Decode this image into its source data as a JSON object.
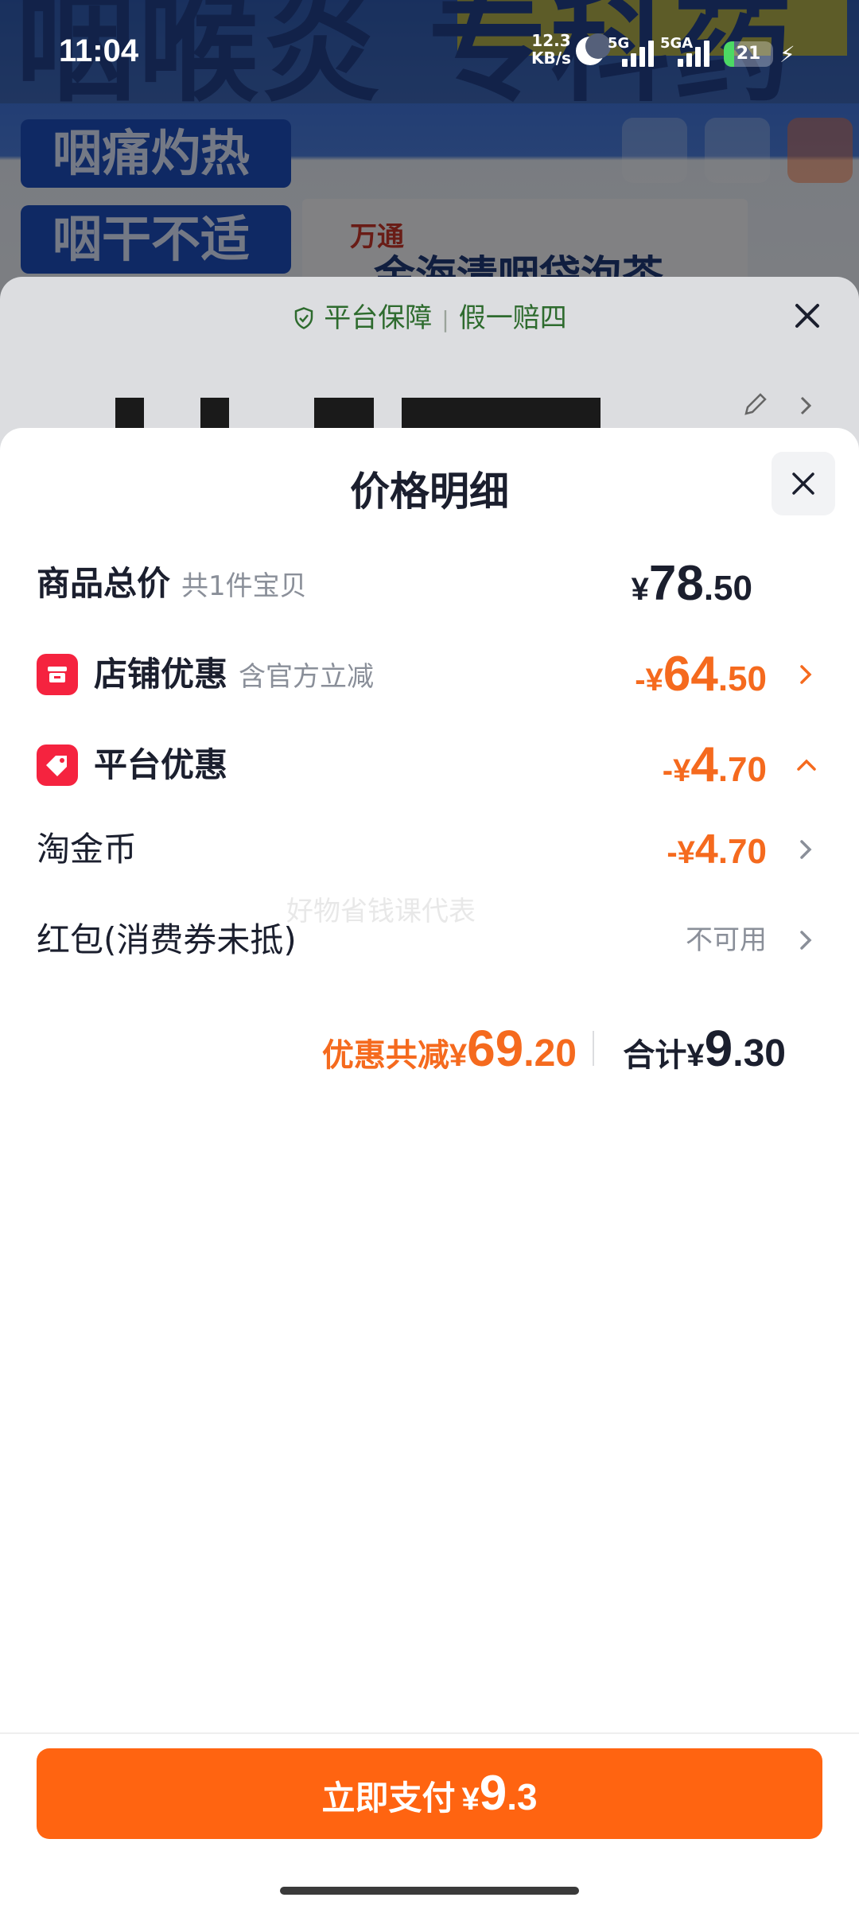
{
  "status_bar": {
    "time": "11:04",
    "net_speed_value": "12.3",
    "net_speed_unit": "KB/s",
    "sim1": "5G",
    "sim2": "5GA",
    "battery": "21",
    "battery_level": 0.21
  },
  "background": {
    "banner_text": "咽喉炎 专科药",
    "tags": [
      "咽痛灼热",
      "咽干不适"
    ],
    "brand": "万通",
    "product_title": "金海清咽袋泡茶"
  },
  "under_sheet": {
    "guarantee_main": "平台保障",
    "guarantee_sub": "假一赔四"
  },
  "sheet": {
    "title": "价格明细",
    "rows": {
      "total": {
        "label": "商品总价",
        "sub": "共1件宝贝",
        "currency": "¥",
        "int": "78",
        "dec": ".50"
      },
      "store": {
        "label": "店铺优惠",
        "sub": "含官方立减",
        "prefix": "-¥",
        "int": "64",
        "dec": ".50"
      },
      "platform": {
        "label": "平台优惠",
        "prefix": "-¥",
        "int": "4",
        "dec": ".70"
      },
      "coins": {
        "label": "淘金币",
        "prefix": "-¥",
        "int": "4",
        "dec": ".70"
      },
      "redpacket": {
        "label": "红包(消费券未抵)",
        "status": "不可用"
      }
    },
    "watermark": "好物省钱课代表",
    "summary": {
      "discount_label": "优惠共减",
      "discount_currency": "¥",
      "discount_int": "69",
      "discount_dec": ".20",
      "total_label": "合计",
      "total_currency": "¥",
      "total_int": "9",
      "total_dec": ".30"
    },
    "pay_button": {
      "label": "立即支付",
      "currency": "¥",
      "int": "9",
      "dec": ".3"
    }
  },
  "colors": {
    "accent_orange": "#f56a1e",
    "pay_button": "#ff6411",
    "icon_red": "#f5233f",
    "text_dark": "#1b1f2e",
    "text_gray": "#8a8f99"
  },
  "icons": {
    "store_discount": "store-icon",
    "platform_discount": "tag-icon",
    "close": "close-icon",
    "chevron": "chevron-right-icon",
    "collapse": "chevron-up-icon"
  }
}
